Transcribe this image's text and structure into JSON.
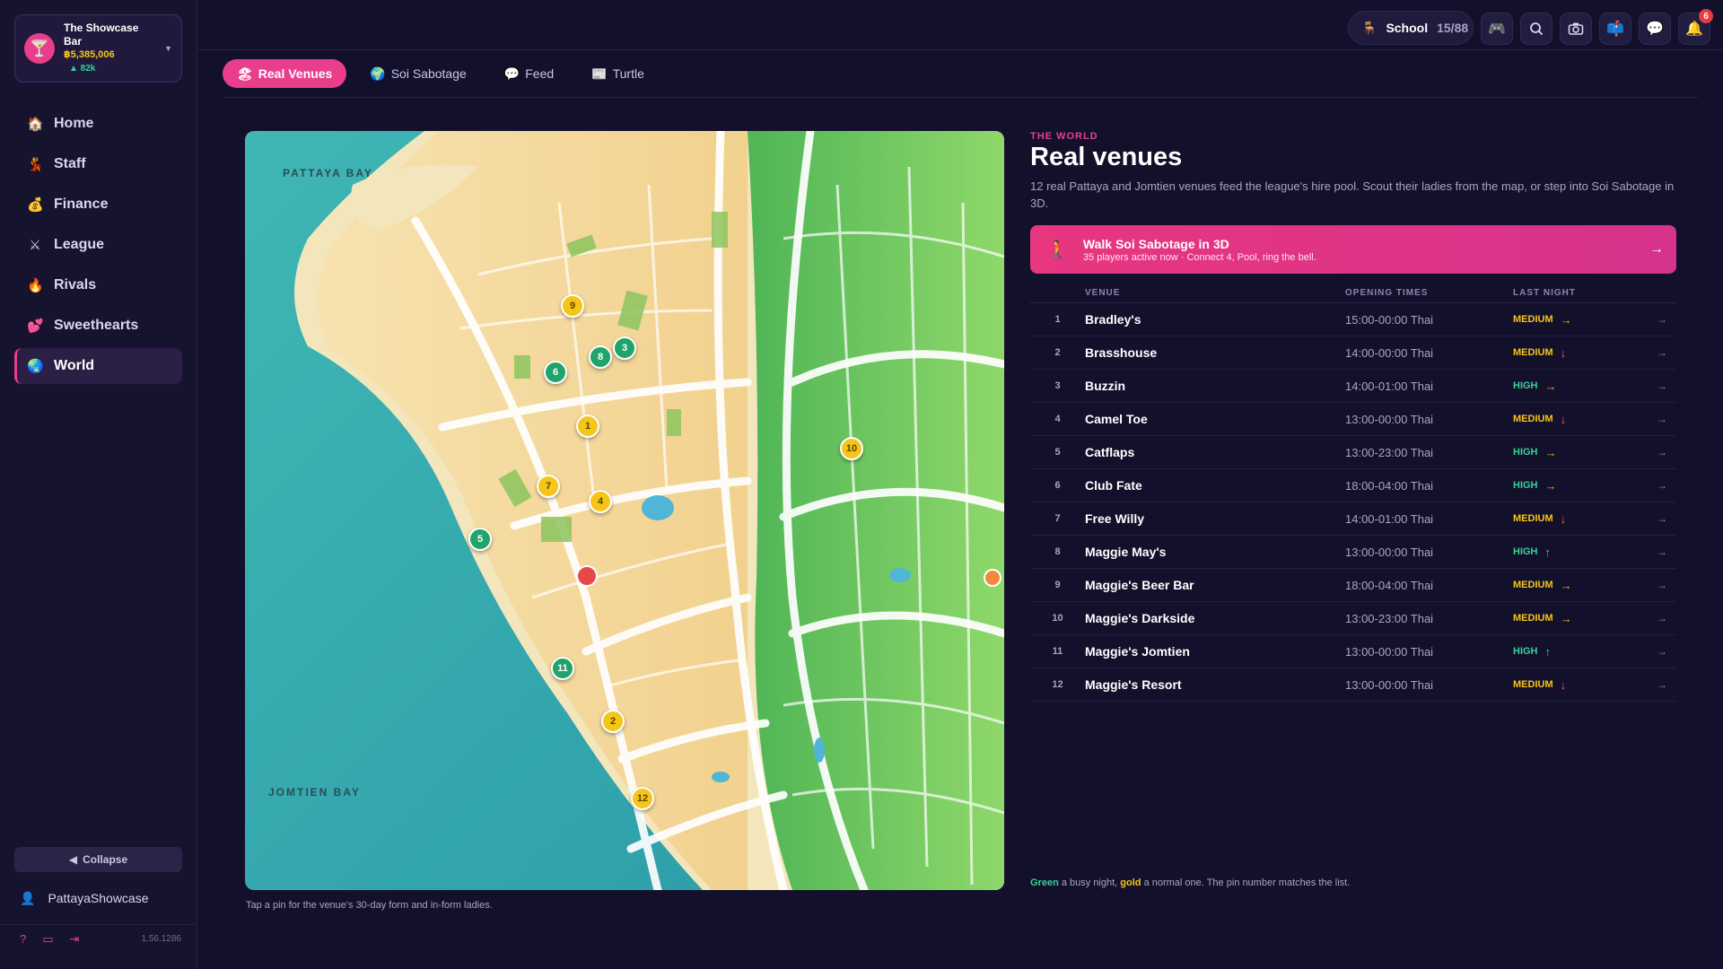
{
  "sidebar": {
    "bar": {
      "name": "The Showcase Bar",
      "money": "฿5,385,006",
      "delta": "▲ 82k"
    },
    "nav": [
      {
        "icon": "🏠",
        "label": "Home",
        "active": false
      },
      {
        "icon": "💃",
        "label": "Staff",
        "active": false
      },
      {
        "icon": "💰",
        "label": "Finance",
        "active": false
      },
      {
        "icon": "⚔",
        "label": "League",
        "active": false
      },
      {
        "icon": "🔥",
        "label": "Rivals",
        "active": false
      },
      {
        "icon": "💕",
        "label": "Sweethearts",
        "active": false
      },
      {
        "icon": "🌏",
        "label": "World",
        "active": true
      }
    ],
    "collapse_label": "Collapse",
    "username": "PattayaShowcase",
    "version": "1.56.1286"
  },
  "topbar": {
    "school_label": "School",
    "school_count": "15/88",
    "notification_count": "6"
  },
  "tabs": [
    {
      "icon": "🏖",
      "label": "Real Venues",
      "active": true
    },
    {
      "icon": "🌍",
      "label": "Soi Sabotage",
      "active": false
    },
    {
      "icon": "💬",
      "label": "Feed",
      "active": false
    },
    {
      "icon": "📰",
      "label": "Turtle",
      "active": false
    }
  ],
  "map": {
    "label_north": "PATTAYA BAY",
    "label_south": "JOMTIEN BAY",
    "caption": "Tap a pin for the venue's 30-day form and in-form ladies.",
    "pins": [
      {
        "n": "1",
        "kind": "gold"
      },
      {
        "n": "2",
        "kind": "gold"
      },
      {
        "n": "3",
        "kind": "green"
      },
      {
        "n": "4",
        "kind": "gold"
      },
      {
        "n": "5",
        "kind": "green"
      },
      {
        "n": "6",
        "kind": "green"
      },
      {
        "n": "7",
        "kind": "gold"
      },
      {
        "n": "8",
        "kind": "green"
      },
      {
        "n": "9",
        "kind": "gold"
      },
      {
        "n": "10",
        "kind": "gold"
      },
      {
        "n": "11",
        "kind": "green"
      },
      {
        "n": "12",
        "kind": "gold"
      }
    ]
  },
  "panel": {
    "eyebrow": "THE WORLD",
    "title": "Real venues",
    "description": "12 real Pattaya and Jomtien venues feed the league's hire pool. Scout their ladies from the map, or step into Soi Sabotage in 3D.",
    "cta_title": "Walk Soi Sabotage in 3D",
    "cta_subtitle": "35 players active now · Connect 4, Pool, ring the bell.",
    "cta_arrow": "→",
    "columns": {
      "venue": "VENUE",
      "times": "OPENING TIMES",
      "last": "LAST NIGHT"
    },
    "venues": [
      {
        "n": "1",
        "name": "Bradley's",
        "times": "15:00-00:00 Thai",
        "level": "MEDIUM",
        "trend": "flat"
      },
      {
        "n": "2",
        "name": "Brasshouse",
        "times": "14:00-00:00 Thai",
        "level": "MEDIUM",
        "trend": "down"
      },
      {
        "n": "3",
        "name": "Buzzin",
        "times": "14:00-01:00 Thai",
        "level": "HIGH",
        "trend": "flat"
      },
      {
        "n": "4",
        "name": "Camel Toe",
        "times": "13:00-00:00 Thai",
        "level": "MEDIUM",
        "trend": "down"
      },
      {
        "n": "5",
        "name": "Catflaps",
        "times": "13:00-23:00 Thai",
        "level": "HIGH",
        "trend": "flat"
      },
      {
        "n": "6",
        "name": "Club Fate",
        "times": "18:00-04:00 Thai",
        "level": "HIGH",
        "trend": "flat"
      },
      {
        "n": "7",
        "name": "Free Willy",
        "times": "14:00-01:00 Thai",
        "level": "MEDIUM",
        "trend": "down"
      },
      {
        "n": "8",
        "name": "Maggie May's",
        "times": "13:00-00:00 Thai",
        "level": "HIGH",
        "trend": "up"
      },
      {
        "n": "9",
        "name": "Maggie's Beer Bar",
        "times": "18:00-04:00 Thai",
        "level": "MEDIUM",
        "trend": "flat"
      },
      {
        "n": "10",
        "name": "Maggie's Darkside",
        "times": "13:00-23:00 Thai",
        "level": "MEDIUM",
        "trend": "flat"
      },
      {
        "n": "11",
        "name": "Maggie's Jomtien",
        "times": "13:00-00:00 Thai",
        "level": "HIGH",
        "trend": "up"
      },
      {
        "n": "12",
        "name": "Maggie's Resort",
        "times": "13:00-00:00 Thai",
        "level": "MEDIUM",
        "trend": "down"
      }
    ],
    "legend_green": "Green",
    "legend_mid": " a busy night, ",
    "legend_gold": "gold",
    "legend_end": " a normal one. The pin number matches the list."
  },
  "colors": {
    "accent": "#e83e8c",
    "high": "#34d399",
    "medium": "#f5c518",
    "background": "#13102b"
  }
}
